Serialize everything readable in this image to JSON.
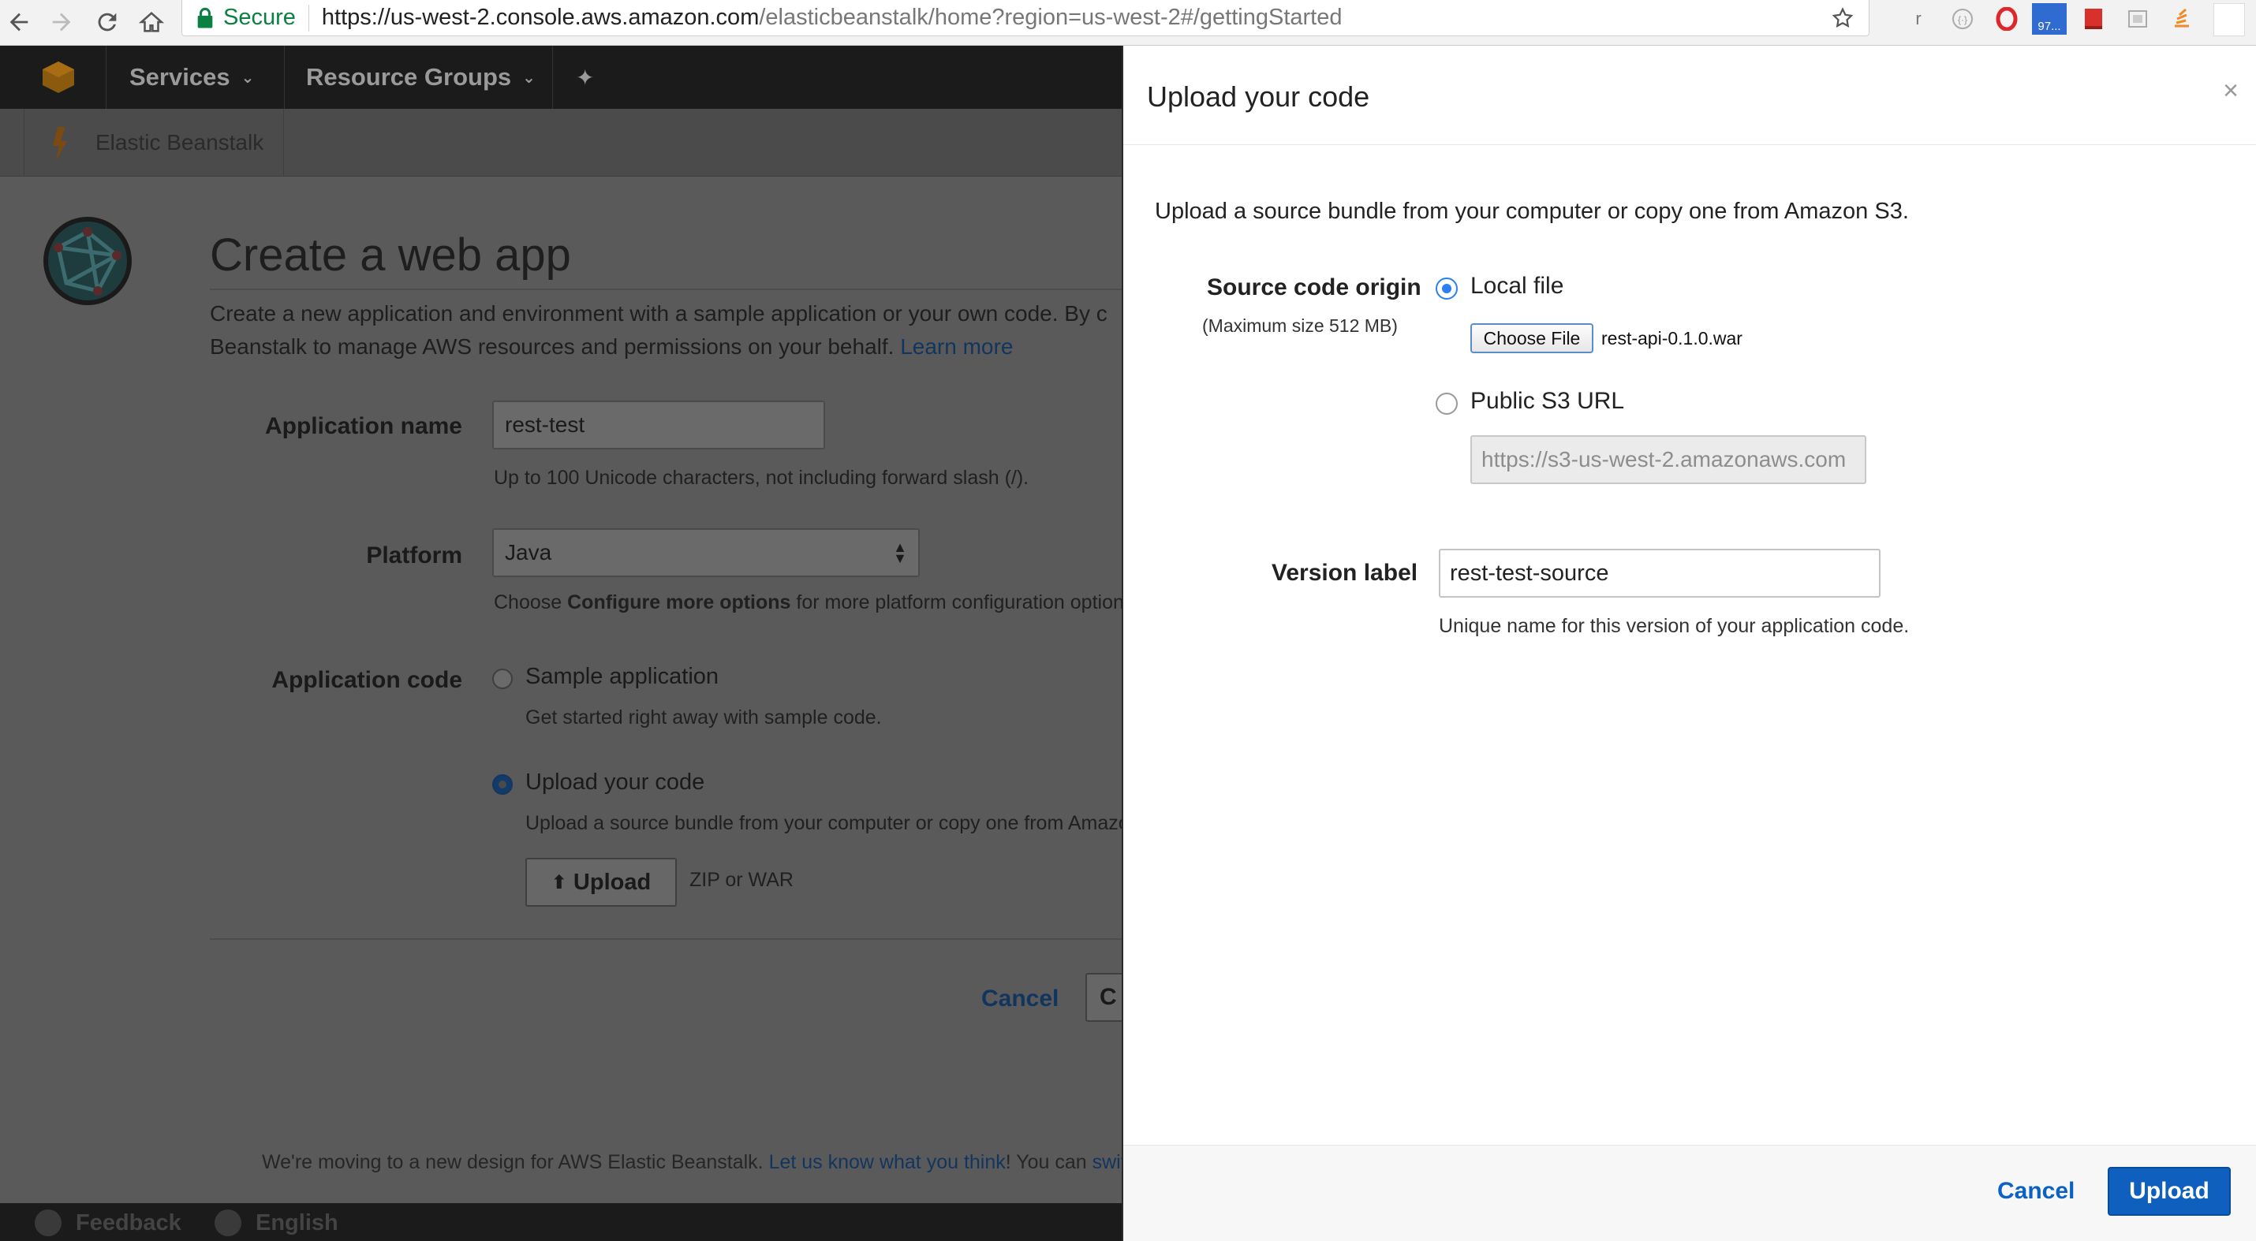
{
  "browser": {
    "secure_label": "Secure",
    "url_host": "https://us-west-2.console.aws.amazon.com",
    "url_path": "/elasticbeanstalk/home?region=us-west-2#/gettingStarted",
    "ext_r": "r",
    "ext_badge": "97..."
  },
  "aws_nav": {
    "services": "Services",
    "resource_groups": "Resource Groups",
    "service_name": "Elastic Beanstalk"
  },
  "page": {
    "title": "Create a web app",
    "intro_line1": "Create a new application and environment with a sample application or your own code. By c",
    "intro_line2": "Beanstalk to manage AWS resources and permissions on your behalf.",
    "learn_more": "Learn more",
    "app_name_label": "Application name",
    "app_name_value": "rest-test",
    "app_name_help": "Up to 100 Unicode characters, not including forward slash (/).",
    "platform_label": "Platform",
    "platform_value": "Java",
    "platform_help_prefix": "Choose",
    "platform_help_bold": "Configure more options",
    "platform_help_suffix": "for more platform configuration options.",
    "app_code_label": "Application code",
    "sample_label": "Sample application",
    "sample_help": "Get started right away with sample code.",
    "upload_label": "Upload your code",
    "upload_help": "Upload a source bundle from your computer or copy one from Amazon",
    "upload_button": "Upload",
    "upload_format": "ZIP or WAR",
    "cancel": "Cancel",
    "create_partial": "C",
    "banner_prefix": "We're moving to a new design for AWS Elastic Beanstalk.",
    "banner_link": "Let us know what you think",
    "banner_suffix": "! You can",
    "banner_switch": "switch",
    "feedback": "Feedback",
    "language": "English"
  },
  "modal": {
    "title": "Upload your code",
    "close": "×",
    "intro": "Upload a source bundle from your computer or copy one from Amazon S3.",
    "source_origin_label": "Source code origin",
    "source_origin_sub": "(Maximum size 512 MB)",
    "local_file_label": "Local file",
    "choose_file": "Choose File",
    "file_name": "rest-api-0.1.0.war",
    "s3_label": "Public S3 URL",
    "s3_placeholder": "https://s3-us-west-2.amazonaws.com",
    "version_label": "Version label",
    "version_value": "rest-test-source",
    "version_help": "Unique name for this version of your application code.",
    "cancel": "Cancel",
    "upload": "Upload"
  },
  "colors": {
    "aws_nav": "#1b1b1b",
    "accent_blue": "#0f5fbe",
    "secure_green": "#0b8043"
  }
}
